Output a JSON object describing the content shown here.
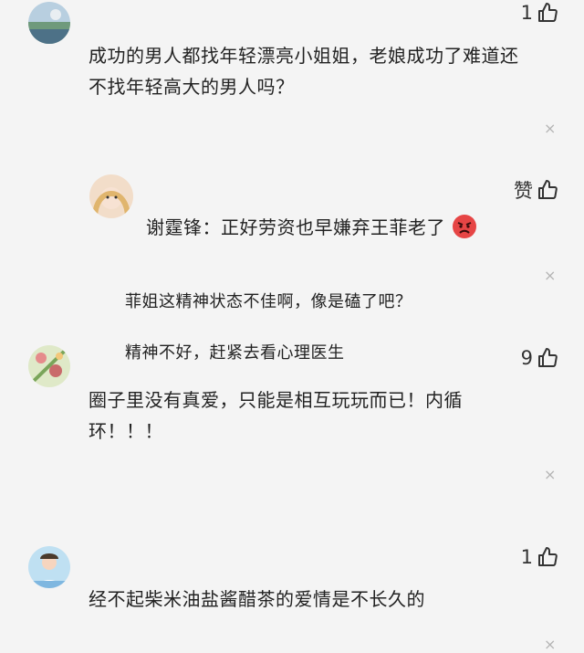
{
  "comments": [
    {
      "likes": "1",
      "text_lines": [
        "成功的男人都找年轻漂亮小姐姐，老娘成功了难道还",
        "不找年轻高大的男人吗？"
      ]
    },
    {
      "likes": "赞",
      "text": "谢霆锋：正好劳资也早嫌弃王菲老了"
    },
    {
      "likes": "",
      "text": "菲姐这精神状态不佳啊，像是磕了吧？"
    },
    {
      "likes": "9",
      "overlay_text": "精神不好，赶紧去看心理医生",
      "text_lines": [
        "圈子里没有真爱，只能是相互玩玩而已！内循",
        "环！！！"
      ]
    },
    {
      "likes": "1",
      "text": "经不起柴米油盐酱醋茶的爱情是不长久的"
    }
  ],
  "close_symbol": "×",
  "icons": {
    "like": "thumbs-up-icon",
    "close": "close-icon",
    "emoji": "angry-face-emoji-icon"
  }
}
